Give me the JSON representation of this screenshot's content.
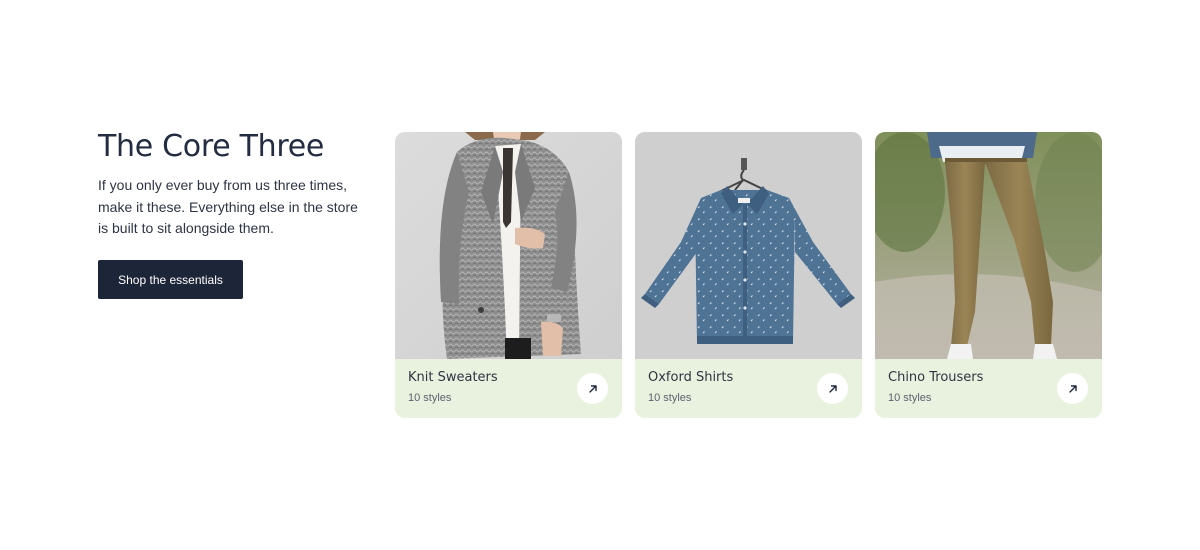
{
  "section": {
    "title": "The Core Three",
    "description": "If you only ever buy from us three times, make it these. Everything else in the store is built to sit alongside them.",
    "cta_label": "Shop the essentials"
  },
  "cards": [
    {
      "title": "Knit Sweaters",
      "count": "10 styles",
      "image": "woman-grey-blazer-photo",
      "icon": "arrow-up-right-icon"
    },
    {
      "title": "Oxford Shirts",
      "count": "10 styles",
      "image": "denim-shirt-on-hanger-photo",
      "icon": "arrow-up-right-icon"
    },
    {
      "title": "Chino Trousers",
      "count": "10 styles",
      "image": "khaki-chinos-outdoor-photo",
      "icon": "arrow-up-right-icon"
    }
  ],
  "colors": {
    "primary": "#1d2638",
    "card_footer": "#e9f2de",
    "background": "#ffffff"
  }
}
